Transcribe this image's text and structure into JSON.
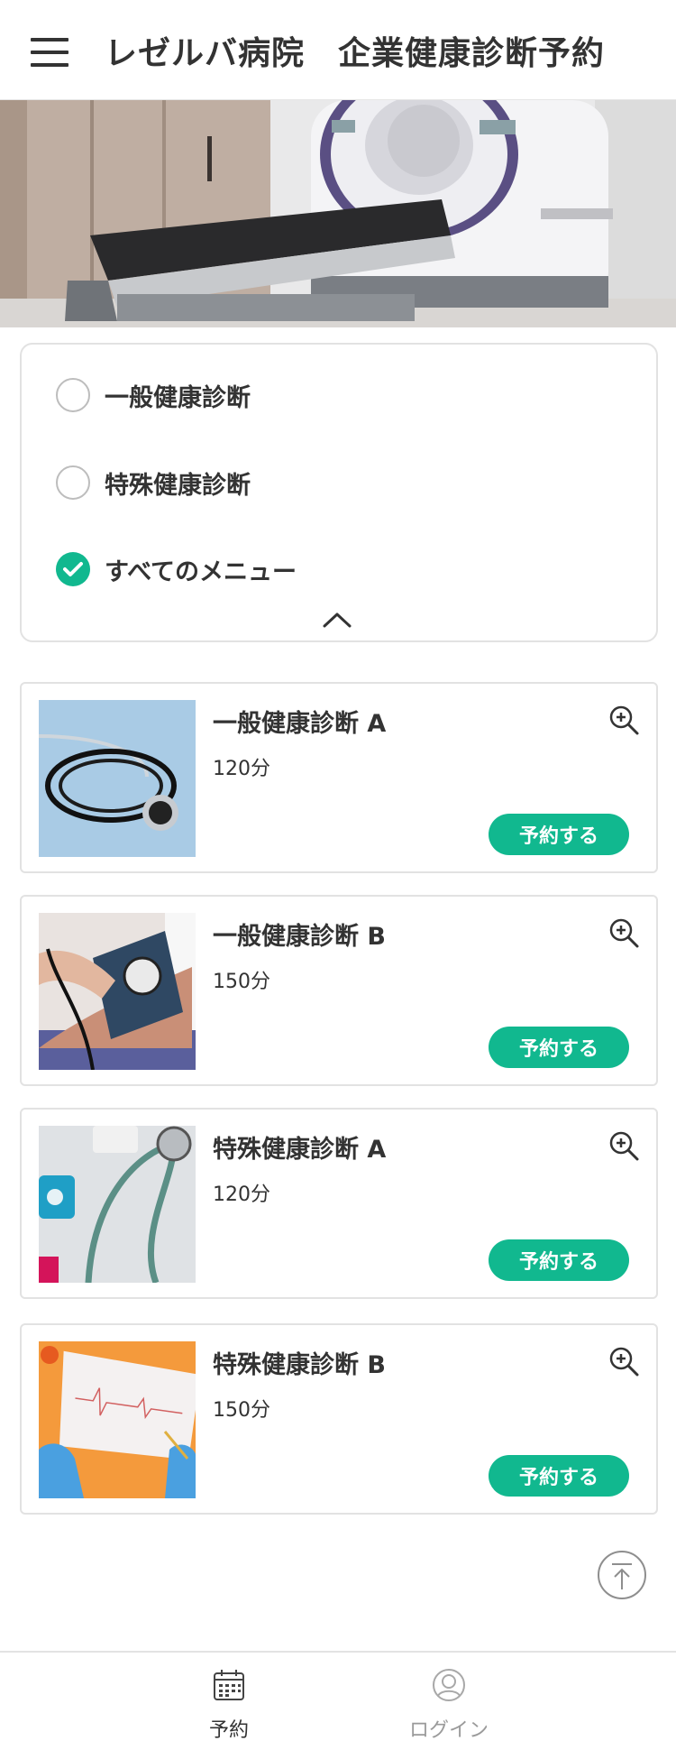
{
  "header": {
    "title": "レゼルバ病院　企業健康診断予約",
    "menu_icon": "hamburger-icon"
  },
  "filter": {
    "options": [
      {
        "label": "一般健康診断",
        "checked": false
      },
      {
        "label": "特殊健康診断",
        "checked": false
      },
      {
        "label": "すべてのメニュー",
        "checked": true
      }
    ],
    "collapse_icon": "chevron-up-icon"
  },
  "menus": [
    {
      "title": "一般健康診断 A",
      "duration": "120分",
      "button": "予約する",
      "image": "stethoscope-photo"
    },
    {
      "title": "一般健康診断 B",
      "duration": "150分",
      "button": "予約する",
      "image": "blood-pressure-photo"
    },
    {
      "title": "特殊健康診断 A",
      "duration": "120分",
      "button": "予約する",
      "image": "stethoscope-pills-photo"
    },
    {
      "title": "特殊健康診断 B",
      "duration": "150分",
      "button": "予約する",
      "image": "ecg-chart-photo"
    }
  ],
  "nav": {
    "reserve_label": "予約",
    "login_label": "ログイン"
  },
  "colors": {
    "accent": "#11b88f",
    "text": "#333333",
    "muted": "#9a9a9a",
    "border": "#e2e2e2"
  }
}
